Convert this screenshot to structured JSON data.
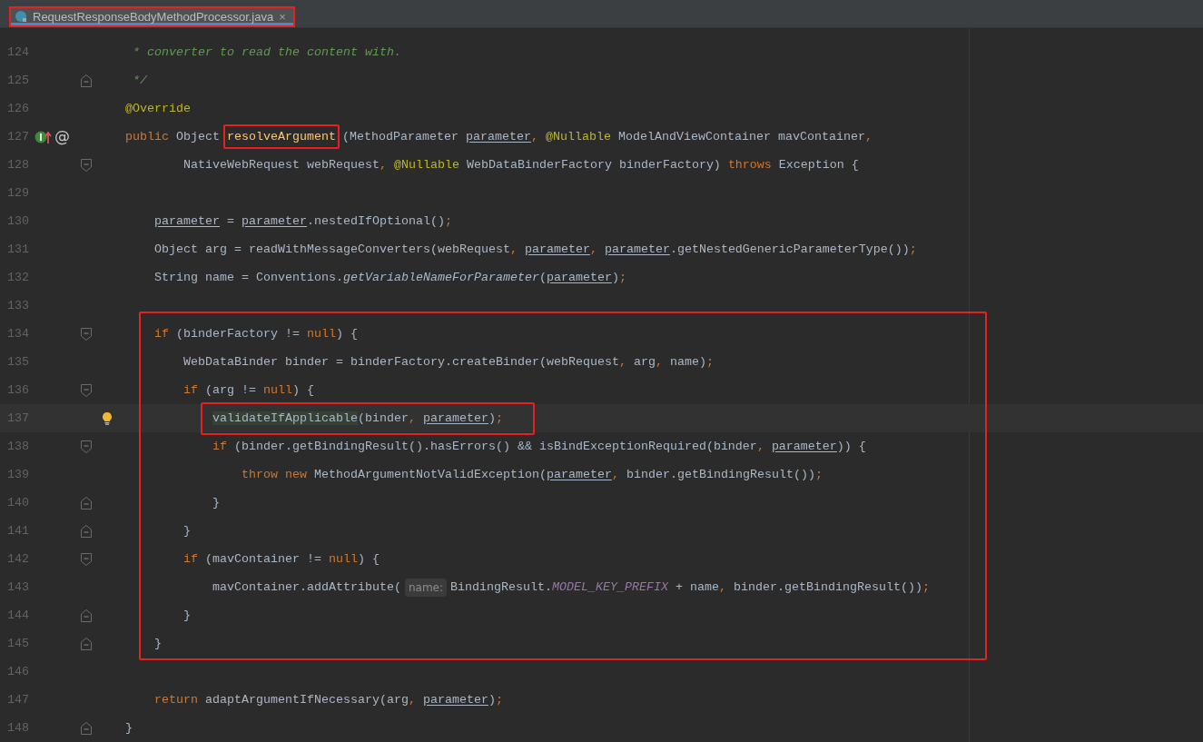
{
  "editor_tabs": [
    {
      "title": "RequestResponseBodyMethodProcessor.java",
      "selected": true,
      "boxed": true,
      "close": "×"
    }
  ],
  "code": [
    {
      "number": "124",
      "doc_comment": true,
      "tokens": [
        {
          "kind": "comment",
          "text": "* converter to read the content with."
        }
      ]
    },
    {
      "number": "125",
      "doc_comment": true,
      "fold_marker": true,
      "fold_closing": true,
      "tokens": [
        {
          "kind": "comment",
          "text": "*/"
        }
      ]
    },
    {
      "number": "126",
      "tokens": [
        {
          "kind": "annotation",
          "text": "@Override"
        }
      ]
    },
    {
      "number": "127",
      "gutter_icons": [
        {
          "kind": "implements"
        },
        {
          "kind": "glyph",
          "text": "@"
        }
      ],
      "tokens": [
        {
          "kind": "keyword",
          "text": "public"
        },
        {
          "kind": "plain",
          "text": " Object "
        },
        {
          "kind": "method",
          "text": "resolveArgument",
          "boxed": true
        },
        {
          "kind": "plain",
          "text": "(MethodParameter "
        },
        {
          "kind": "param",
          "text": "parameter"
        },
        {
          "kind": "keyword",
          "text": ", "
        },
        {
          "kind": "annotation",
          "text": "@Nullable"
        },
        {
          "kind": "plain",
          "text": " ModelAndViewContainer mavContainer"
        },
        {
          "kind": "keyword",
          "text": ","
        }
      ],
      "children": [
        {
          "number": "128",
          "continuation": true,
          "fold_marker": true,
          "fold_closing": false,
          "tokens": [
            {
              "kind": "plain",
              "text": "NativeWebRequest webRequest"
            },
            {
              "kind": "keyword",
              "text": ", "
            },
            {
              "kind": "annotation",
              "text": "@Nullable"
            },
            {
              "kind": "plain",
              "text": " WebDataBinderFactory binderFactory) "
            },
            {
              "kind": "keyword",
              "text": "throws"
            },
            {
              "kind": "plain",
              "text": " Exception {"
            }
          ]
        },
        {
          "number": "129"
        },
        {
          "number": "130",
          "tokens": [
            {
              "kind": "param",
              "text": "parameter"
            },
            {
              "kind": "plain",
              "text": " = "
            },
            {
              "kind": "param",
              "text": "parameter"
            },
            {
              "kind": "plain",
              "text": ".nestedIfOptional()"
            },
            {
              "kind": "keyword",
              "text": ";"
            }
          ]
        },
        {
          "number": "131",
          "tokens": [
            {
              "kind": "plain",
              "text": "Object arg = readWithMessageConverters(webRequest"
            },
            {
              "kind": "keyword",
              "text": ", "
            },
            {
              "kind": "param",
              "text": "parameter"
            },
            {
              "kind": "keyword",
              "text": ", "
            },
            {
              "kind": "param",
              "text": "parameter"
            },
            {
              "kind": "plain",
              "text": ".getNestedGenericParameterType())"
            },
            {
              "kind": "keyword",
              "text": ";"
            }
          ]
        },
        {
          "number": "132",
          "tokens": [
            {
              "kind": "plain",
              "text": "String name = Conventions."
            },
            {
              "kind": "static_call",
              "text": "getVariableNameForParameter"
            },
            {
              "kind": "plain",
              "text": "("
            },
            {
              "kind": "param",
              "text": "parameter"
            },
            {
              "kind": "plain",
              "text": ")"
            },
            {
              "kind": "keyword",
              "text": ";"
            }
          ]
        },
        {
          "number": "133"
        },
        {
          "kind": "block",
          "boxed": true,
          "lines": [
            {
              "number": "134",
              "fold_marker": true,
              "fold_closing": false,
              "tokens": [
                {
                  "kind": "keyword",
                  "text": "if"
                },
                {
                  "kind": "plain",
                  "text": " (binderFactory != "
                },
                {
                  "kind": "keyword",
                  "text": "null"
                },
                {
                  "kind": "plain",
                  "text": ") {"
                }
              ],
              "children": [
                {
                  "number": "135",
                  "tokens": [
                    {
                      "kind": "plain",
                      "text": "WebDataBinder binder = binderFactory.createBinder(webRequest"
                    },
                    {
                      "kind": "keyword",
                      "text": ", "
                    },
                    {
                      "kind": "plain",
                      "text": "arg"
                    },
                    {
                      "kind": "keyword",
                      "text": ", "
                    },
                    {
                      "kind": "plain",
                      "text": "name)"
                    },
                    {
                      "kind": "keyword",
                      "text": ";"
                    }
                  ]
                },
                {
                  "number": "136",
                  "fold_marker": true,
                  "fold_closing": false,
                  "tokens": [
                    {
                      "kind": "keyword",
                      "text": "if"
                    },
                    {
                      "kind": "plain",
                      "text": " (arg != "
                    },
                    {
                      "kind": "keyword",
                      "text": "null"
                    },
                    {
                      "kind": "plain",
                      "text": ") {"
                    }
                  ],
                  "children": [
                    {
                      "number": "137",
                      "caret": true,
                      "boxed": true,
                      "gutter_icons": [
                        {
                          "kind": "bulb"
                        }
                      ],
                      "tokens": [
                        {
                          "kind": "usage",
                          "text": "validateIfApplicable"
                        },
                        {
                          "kind": "plain",
                          "text": "(binder"
                        },
                        {
                          "kind": "keyword",
                          "text": ", "
                        },
                        {
                          "kind": "param",
                          "text": "parameter"
                        },
                        {
                          "kind": "plain",
                          "text": ")"
                        },
                        {
                          "kind": "keyword",
                          "text": ";"
                        }
                      ]
                    },
                    {
                      "number": "138",
                      "fold_marker": true,
                      "fold_closing": false,
                      "tokens": [
                        {
                          "kind": "keyword",
                          "text": "if"
                        },
                        {
                          "kind": "plain",
                          "text": " (binder.getBindingResult().hasErrors() && isBindExceptionRequired(binder"
                        },
                        {
                          "kind": "keyword",
                          "text": ", "
                        },
                        {
                          "kind": "param",
                          "text": "parameter"
                        },
                        {
                          "kind": "plain",
                          "text": ")) {"
                        }
                      ],
                      "children": [
                        {
                          "number": "139",
                          "tokens": [
                            {
                              "kind": "keyword",
                              "text": "throw new"
                            },
                            {
                              "kind": "plain",
                              "text": " MethodArgumentNotValidException("
                            },
                            {
                              "kind": "param",
                              "text": "parameter"
                            },
                            {
                              "kind": "keyword",
                              "text": ", "
                            },
                            {
                              "kind": "plain",
                              "text": "binder.getBindingResult())"
                            },
                            {
                              "kind": "keyword",
                              "text": ";"
                            }
                          ]
                        }
                      ]
                    },
                    {
                      "number": "140",
                      "fold_marker": true,
                      "fold_closing": true,
                      "tokens": [
                        {
                          "kind": "plain",
                          "text": "}"
                        }
                      ]
                    }
                  ]
                },
                {
                  "number": "141",
                  "fold_marker": true,
                  "fold_closing": true,
                  "tokens": [
                    {
                      "kind": "plain",
                      "text": "}"
                    }
                  ]
                },
                {
                  "number": "142",
                  "fold_marker": true,
                  "fold_closing": false,
                  "tokens": [
                    {
                      "kind": "keyword",
                      "text": "if"
                    },
                    {
                      "kind": "plain",
                      "text": " (mavContainer != "
                    },
                    {
                      "kind": "keyword",
                      "text": "null"
                    },
                    {
                      "kind": "plain",
                      "text": ") {"
                    }
                  ],
                  "children": [
                    {
                      "number": "143",
                      "tokens": [
                        {
                          "kind": "plain",
                          "text": "mavContainer.addAttribute("
                        },
                        {
                          "kind": "hint",
                          "text": "name:"
                        },
                        {
                          "kind": "plain",
                          "text": "BindingResult."
                        },
                        {
                          "kind": "static",
                          "text": "MODEL_KEY_PREFIX"
                        },
                        {
                          "kind": "plain",
                          "text": " + name"
                        },
                        {
                          "kind": "keyword",
                          "text": ", "
                        },
                        {
                          "kind": "plain",
                          "text": "binder.getBindingResult())"
                        },
                        {
                          "kind": "keyword",
                          "text": ";"
                        }
                      ]
                    }
                  ]
                },
                {
                  "number": "144",
                  "fold_marker": true,
                  "fold_closing": true,
                  "tokens": [
                    {
                      "kind": "plain",
                      "text": "}"
                    }
                  ]
                }
              ]
            },
            {
              "number": "145",
              "fold_marker": true,
              "fold_closing": true,
              "tokens": [
                {
                  "kind": "plain",
                  "text": "}"
                }
              ]
            }
          ]
        },
        {
          "number": "146"
        },
        {
          "number": "147",
          "tokens": [
            {
              "kind": "keyword",
              "text": "return"
            },
            {
              "kind": "plain",
              "text": " adaptArgumentIfNecessary(arg"
            },
            {
              "kind": "keyword",
              "text": ", "
            },
            {
              "kind": "param",
              "text": "parameter"
            },
            {
              "kind": "plain",
              "text": ")"
            },
            {
              "kind": "keyword",
              "text": ";"
            }
          ]
        }
      ]
    },
    {
      "number": "148",
      "fold_marker": true,
      "fold_closing": true,
      "tokens": [
        {
          "kind": "plain",
          "text": "}"
        }
      ]
    }
  ]
}
